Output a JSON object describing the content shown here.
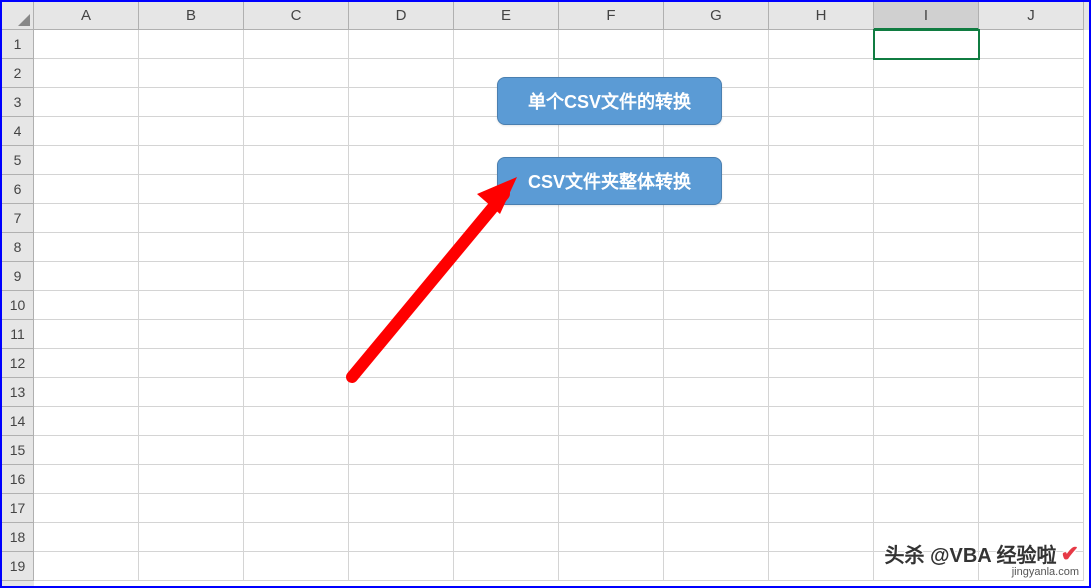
{
  "columns": [
    "A",
    "B",
    "C",
    "D",
    "E",
    "F",
    "G",
    "H",
    "I",
    "J"
  ],
  "rows": [
    "1",
    "2",
    "3",
    "4",
    "5",
    "6",
    "7",
    "8",
    "9",
    "10",
    "11",
    "12",
    "13",
    "14",
    "15",
    "16",
    "17",
    "18",
    "19"
  ],
  "active_column_index": 8,
  "buttons": {
    "convert_single": "单个CSV文件的转换",
    "convert_folder": "CSV文件夹整体转换"
  },
  "watermark": {
    "main": "头杀 @VBA 经验啦",
    "sub": "jingyanla.com"
  }
}
